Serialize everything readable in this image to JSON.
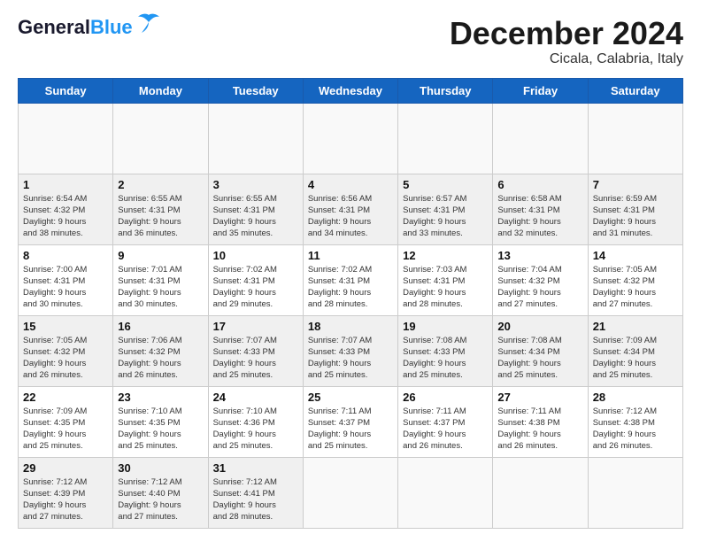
{
  "header": {
    "logo_general": "General",
    "logo_blue": "Blue",
    "title": "December 2024",
    "subtitle": "Cicala, Calabria, Italy"
  },
  "calendar": {
    "days_of_week": [
      "Sunday",
      "Monday",
      "Tuesday",
      "Wednesday",
      "Thursday",
      "Friday",
      "Saturday"
    ],
    "weeks": [
      [
        {
          "day": null,
          "info": ""
        },
        {
          "day": null,
          "info": ""
        },
        {
          "day": null,
          "info": ""
        },
        {
          "day": null,
          "info": ""
        },
        {
          "day": null,
          "info": ""
        },
        {
          "day": null,
          "info": ""
        },
        {
          "day": null,
          "info": ""
        }
      ],
      [
        {
          "day": "1",
          "info": "Sunrise: 6:54 AM\nSunset: 4:32 PM\nDaylight: 9 hours\nand 38 minutes."
        },
        {
          "day": "2",
          "info": "Sunrise: 6:55 AM\nSunset: 4:31 PM\nDaylight: 9 hours\nand 36 minutes."
        },
        {
          "day": "3",
          "info": "Sunrise: 6:55 AM\nSunset: 4:31 PM\nDaylight: 9 hours\nand 35 minutes."
        },
        {
          "day": "4",
          "info": "Sunrise: 6:56 AM\nSunset: 4:31 PM\nDaylight: 9 hours\nand 34 minutes."
        },
        {
          "day": "5",
          "info": "Sunrise: 6:57 AM\nSunset: 4:31 PM\nDaylight: 9 hours\nand 33 minutes."
        },
        {
          "day": "6",
          "info": "Sunrise: 6:58 AM\nSunset: 4:31 PM\nDaylight: 9 hours\nand 32 minutes."
        },
        {
          "day": "7",
          "info": "Sunrise: 6:59 AM\nSunset: 4:31 PM\nDaylight: 9 hours\nand 31 minutes."
        }
      ],
      [
        {
          "day": "8",
          "info": "Sunrise: 7:00 AM\nSunset: 4:31 PM\nDaylight: 9 hours\nand 30 minutes."
        },
        {
          "day": "9",
          "info": "Sunrise: 7:01 AM\nSunset: 4:31 PM\nDaylight: 9 hours\nand 30 minutes."
        },
        {
          "day": "10",
          "info": "Sunrise: 7:02 AM\nSunset: 4:31 PM\nDaylight: 9 hours\nand 29 minutes."
        },
        {
          "day": "11",
          "info": "Sunrise: 7:02 AM\nSunset: 4:31 PM\nDaylight: 9 hours\nand 28 minutes."
        },
        {
          "day": "12",
          "info": "Sunrise: 7:03 AM\nSunset: 4:31 PM\nDaylight: 9 hours\nand 28 minutes."
        },
        {
          "day": "13",
          "info": "Sunrise: 7:04 AM\nSunset: 4:32 PM\nDaylight: 9 hours\nand 27 minutes."
        },
        {
          "day": "14",
          "info": "Sunrise: 7:05 AM\nSunset: 4:32 PM\nDaylight: 9 hours\nand 27 minutes."
        }
      ],
      [
        {
          "day": "15",
          "info": "Sunrise: 7:05 AM\nSunset: 4:32 PM\nDaylight: 9 hours\nand 26 minutes."
        },
        {
          "day": "16",
          "info": "Sunrise: 7:06 AM\nSunset: 4:32 PM\nDaylight: 9 hours\nand 26 minutes."
        },
        {
          "day": "17",
          "info": "Sunrise: 7:07 AM\nSunset: 4:33 PM\nDaylight: 9 hours\nand 25 minutes."
        },
        {
          "day": "18",
          "info": "Sunrise: 7:07 AM\nSunset: 4:33 PM\nDaylight: 9 hours\nand 25 minutes."
        },
        {
          "day": "19",
          "info": "Sunrise: 7:08 AM\nSunset: 4:33 PM\nDaylight: 9 hours\nand 25 minutes."
        },
        {
          "day": "20",
          "info": "Sunrise: 7:08 AM\nSunset: 4:34 PM\nDaylight: 9 hours\nand 25 minutes."
        },
        {
          "day": "21",
          "info": "Sunrise: 7:09 AM\nSunset: 4:34 PM\nDaylight: 9 hours\nand 25 minutes."
        }
      ],
      [
        {
          "day": "22",
          "info": "Sunrise: 7:09 AM\nSunset: 4:35 PM\nDaylight: 9 hours\nand 25 minutes."
        },
        {
          "day": "23",
          "info": "Sunrise: 7:10 AM\nSunset: 4:35 PM\nDaylight: 9 hours\nand 25 minutes."
        },
        {
          "day": "24",
          "info": "Sunrise: 7:10 AM\nSunset: 4:36 PM\nDaylight: 9 hours\nand 25 minutes."
        },
        {
          "day": "25",
          "info": "Sunrise: 7:11 AM\nSunset: 4:37 PM\nDaylight: 9 hours\nand 25 minutes."
        },
        {
          "day": "26",
          "info": "Sunrise: 7:11 AM\nSunset: 4:37 PM\nDaylight: 9 hours\nand 26 minutes."
        },
        {
          "day": "27",
          "info": "Sunrise: 7:11 AM\nSunset: 4:38 PM\nDaylight: 9 hours\nand 26 minutes."
        },
        {
          "day": "28",
          "info": "Sunrise: 7:12 AM\nSunset: 4:38 PM\nDaylight: 9 hours\nand 26 minutes."
        }
      ],
      [
        {
          "day": "29",
          "info": "Sunrise: 7:12 AM\nSunset: 4:39 PM\nDaylight: 9 hours\nand 27 minutes."
        },
        {
          "day": "30",
          "info": "Sunrise: 7:12 AM\nSunset: 4:40 PM\nDaylight: 9 hours\nand 27 minutes."
        },
        {
          "day": "31",
          "info": "Sunrise: 7:12 AM\nSunset: 4:41 PM\nDaylight: 9 hours\nand 28 minutes."
        },
        {
          "day": null,
          "info": ""
        },
        {
          "day": null,
          "info": ""
        },
        {
          "day": null,
          "info": ""
        },
        {
          "day": null,
          "info": ""
        }
      ]
    ]
  }
}
